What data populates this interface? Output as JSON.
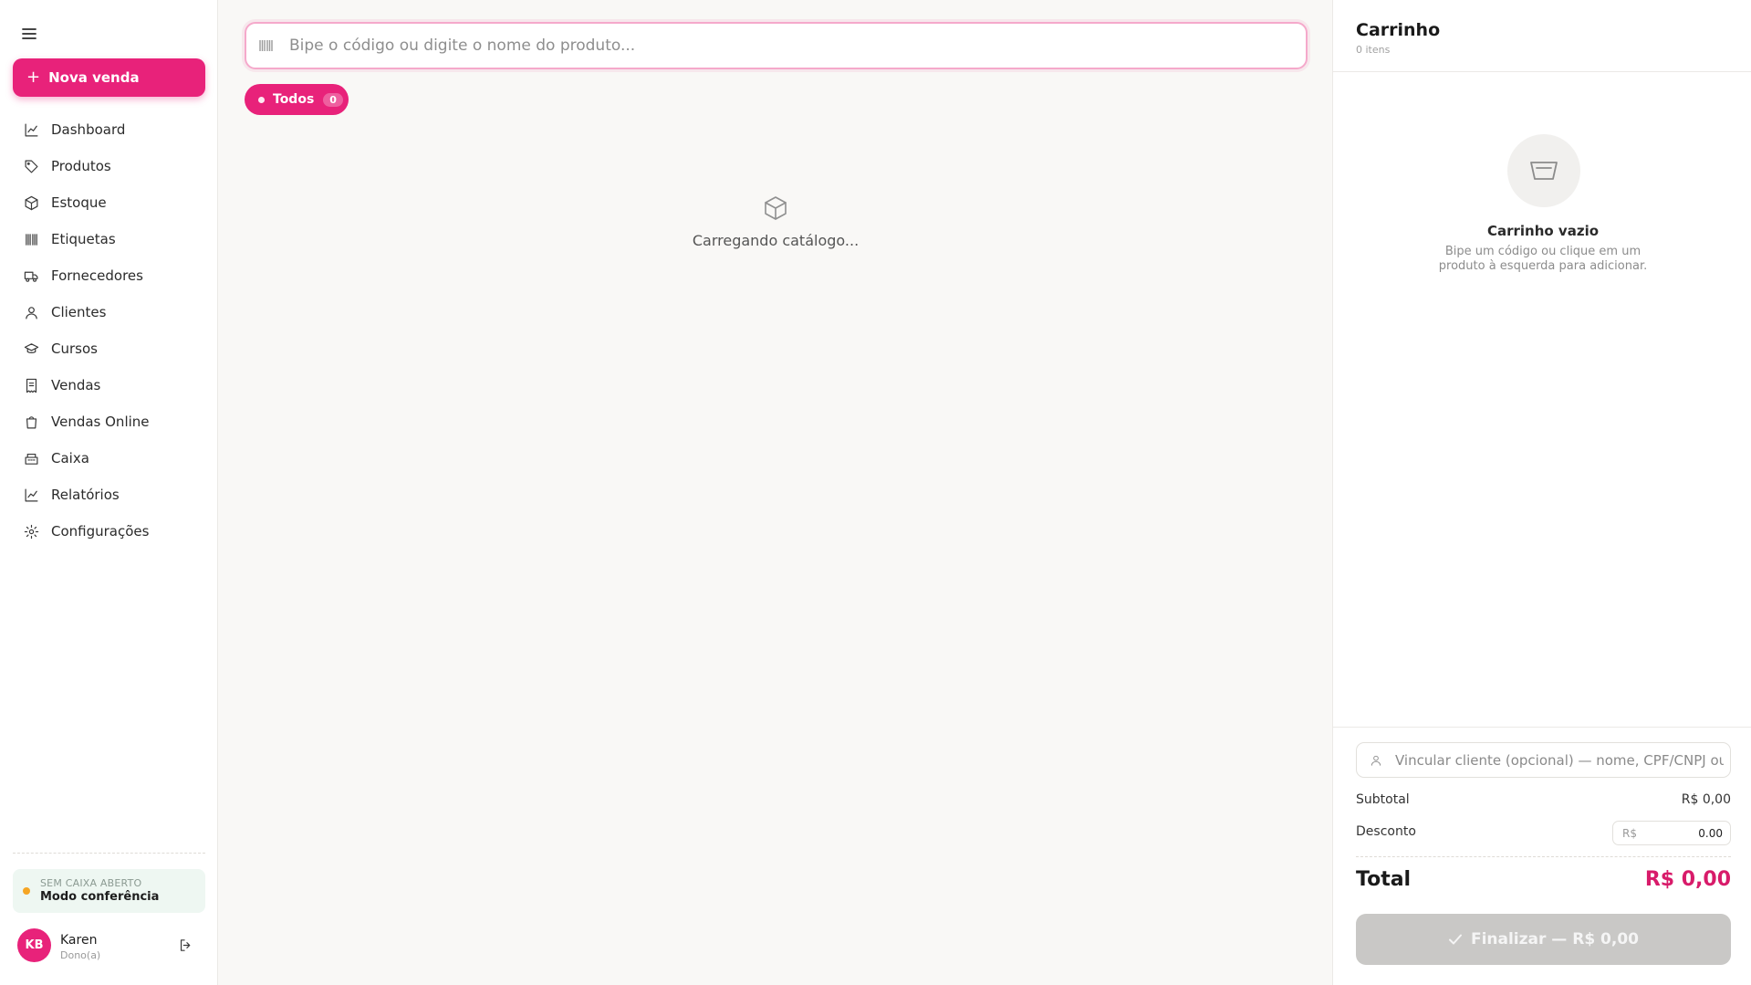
{
  "sidebar": {
    "menu_icon": "hamburger-icon",
    "new_sale_label": "Nova venda",
    "nav_items": [
      {
        "label": "Dashboard",
        "icon": "chart-line-icon"
      },
      {
        "label": "Produtos",
        "icon": "tag-icon"
      },
      {
        "label": "Estoque",
        "icon": "box-icon"
      },
      {
        "label": "Etiquetas",
        "icon": "barcode-icon"
      },
      {
        "label": "Fornecedores",
        "icon": "truck-icon"
      },
      {
        "label": "Clientes",
        "icon": "user-icon"
      },
      {
        "label": "Cursos",
        "icon": "graduation-cap-icon"
      },
      {
        "label": "Vendas",
        "icon": "receipt-icon"
      },
      {
        "label": "Vendas Online",
        "icon": "shopping-bag-icon"
      },
      {
        "label": "Caixa",
        "icon": "cash-register-icon"
      },
      {
        "label": "Relatórios",
        "icon": "chart-line-icon"
      },
      {
        "label": "Configurações",
        "icon": "gear-icon"
      }
    ],
    "cash_status": "SEM CAIXA ABERTO",
    "cash_mode": "Modo conferência",
    "user": {
      "initials": "KB",
      "name": "Karen",
      "role": "Dono(a)"
    }
  },
  "main": {
    "search_placeholder": "Bipe o código ou digite o nome do produto...",
    "filter_chip": {
      "label": "Todos",
      "count": "0"
    },
    "loading_text": "Carregando catálogo..."
  },
  "cart": {
    "title": "Carrinho",
    "count_label": "0 itens",
    "empty_title": "Carrinho vazio",
    "empty_desc": "Bipe um código ou clique em um produto à esquerda para adicionar.",
    "client_placeholder": "Vincular cliente (opcional) — nome, CPF/CNPJ ou c",
    "subtotal_label": "Subtotal",
    "subtotal_value": "R$ 0,00",
    "discount_label": "Desconto",
    "discount_prefix": "R$",
    "discount_value": "0.00",
    "total_label": "Total",
    "total_value": "R$ 0,00",
    "finish_label": "Finalizar — R$ 0,00"
  },
  "colors": {
    "accent": "#e8227a",
    "total": "#d81b6a",
    "disabled_button": "#c9c8c6",
    "cash_dot": "#f5a524"
  }
}
